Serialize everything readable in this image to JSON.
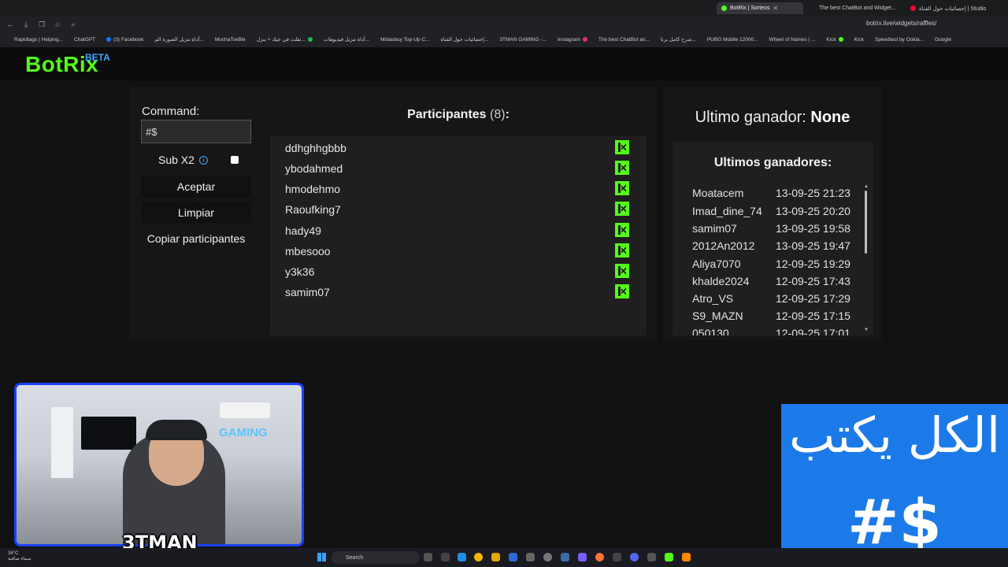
{
  "browser": {
    "tabs": [
      {
        "label": "BotRix | Sorteos",
        "active": true
      },
      {
        "label": "The best ChatBot and Widget...",
        "active": false
      },
      {
        "label": "إحصائيات حول القناة | Studio",
        "active": false
      }
    ],
    "url": "botrix.live/widgets/raffles/",
    "bookmarks": [
      "Rapidtags | Helping...",
      "ChatGPT",
      "(3) Facebook",
      "أداة تنزيل الصورة الم...",
      "MuchaTseBle",
      "نقلت في جيك + ينزل...",
      "أداة تنزيل فيديوهات...",
      "Midasbuy Top-Up C...",
      "إحصائيات حول القناة...",
      "3TMAN GAMING -...",
      "Instagram",
      "The best ChatBot an...",
      "شرح كامل برنا...",
      "PUBG Mobile 12000...",
      "Wheel of Names | ...",
      "Kick",
      "Kick",
      "Speedtest by Ookla...",
      "Google"
    ]
  },
  "app": {
    "logo": "BotRix",
    "beta": "BETA"
  },
  "controls": {
    "command_label": "Command:",
    "command_value": "#$",
    "subx2_label": "Sub X2",
    "subx2_checked": false,
    "accept_label": "Aceptar",
    "clear_label": "Limpiar",
    "copy_label": "Copiar participantes"
  },
  "participants": {
    "title": "Participantes",
    "count": "(8)",
    "colon": ":",
    "items": [
      "ddhghhgbbb",
      "ybodahmed",
      "hmodehmo",
      "Raoufking7",
      "hady49",
      "mbesooo",
      "y3k36",
      "samim07"
    ]
  },
  "winner": {
    "label": "Ultimo ganador:",
    "value": "None"
  },
  "last_winners": {
    "title": "Ultimos ganadores:",
    "items": [
      {
        "name": "Moatacem",
        "date": "13-09-25 21:23"
      },
      {
        "name": "Imad_dine_74",
        "date": "13-09-25 20:20"
      },
      {
        "name": "samim07",
        "date": "13-09-25 19:58"
      },
      {
        "name": "2012An2012",
        "date": "13-09-25 19:47"
      },
      {
        "name": "Aliya7070",
        "date": "12-09-25 19:29"
      },
      {
        "name": "khalde2024",
        "date": "12-09-25 17:43"
      },
      {
        "name": "Atro_VS",
        "date": "12-09-25 17:29"
      },
      {
        "name": "S9_MAZN",
        "date": "12-09-25 17:15"
      },
      {
        "name": "050130",
        "date": "12-09-25 17:01"
      }
    ]
  },
  "stream": {
    "gaming_sign": "GAMING",
    "streamer_name": "3TMAN",
    "overlay_text": "الكل يكتب",
    "overlay_tag": "#$"
  },
  "taskbar": {
    "weather_temp": "34°C",
    "weather_desc": "سماء صافية",
    "search_placeholder": "Search"
  },
  "colors": {
    "brand": "#53fc18",
    "beta": "#3fa7ff",
    "overlay": "#1c7ae8"
  }
}
